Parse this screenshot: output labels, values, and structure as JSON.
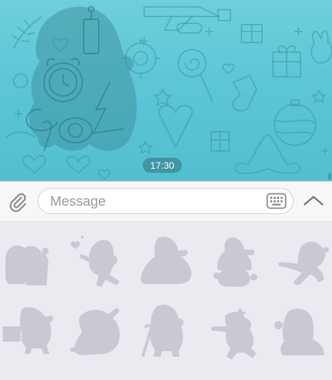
{
  "chat": {
    "timestamp": "17:30"
  },
  "composer": {
    "placeholder": "Message"
  },
  "stickers": [
    {
      "name": "sticker-gnome-couple"
    },
    {
      "name": "sticker-gnome-heart"
    },
    {
      "name": "sticker-gnome-lying"
    },
    {
      "name": "sticker-gnome-cauldron"
    },
    {
      "name": "sticker-gnome-running"
    },
    {
      "name": "sticker-gnome-gift"
    },
    {
      "name": "sticker-gnome-cleaning"
    },
    {
      "name": "sticker-gnome-cane"
    },
    {
      "name": "sticker-gnome-star"
    },
    {
      "name": "sticker-gnome-sitting"
    }
  ],
  "colors": {
    "chat_bg": "#5cc6d5",
    "sticker_placeholder": "#c9c9d2",
    "panel_bg": "#ebeaf1",
    "icon_gray": "#8d8d93"
  }
}
